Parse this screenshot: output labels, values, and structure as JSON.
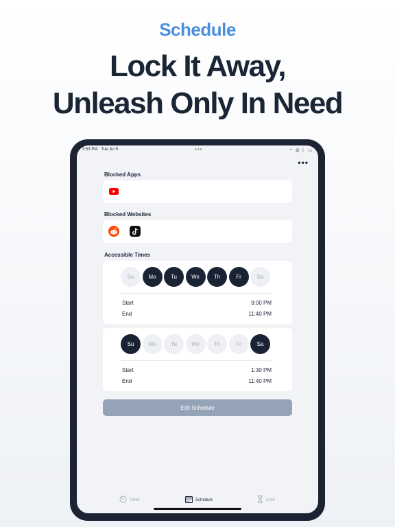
{
  "header": {
    "kicker": "Schedule",
    "headline_line1": "Lock It Away,",
    "headline_line2": "Unleash Only In Need"
  },
  "status_bar": {
    "time": "3:53 PM",
    "date": "Tue Jul 9",
    "dots": "•••",
    "icons": "⌔ ◎ ☾ ▭"
  },
  "more_menu": "•••",
  "blocked_apps": {
    "label": "Blocked Apps",
    "apps": [
      {
        "icon": "youtube-icon"
      }
    ]
  },
  "blocked_websites": {
    "label": "Blocked Websites",
    "sites": [
      {
        "icon": "reddit-icon"
      },
      {
        "icon": "tiktok-icon"
      }
    ]
  },
  "accessible_times": {
    "label": "Accessible Times",
    "schedules": [
      {
        "days": [
          {
            "label": "Su",
            "active": false
          },
          {
            "label": "Mo",
            "active": true
          },
          {
            "label": "Tu",
            "active": true
          },
          {
            "label": "We",
            "active": true
          },
          {
            "label": "Th",
            "active": true
          },
          {
            "label": "Fr",
            "active": true
          },
          {
            "label": "Sa",
            "active": false
          }
        ],
        "start_label": "Start",
        "start": "9:00 PM",
        "end_label": "End",
        "end": "11:40 PM"
      },
      {
        "days": [
          {
            "label": "Su",
            "active": true
          },
          {
            "label": "Mo",
            "active": false
          },
          {
            "label": "Tu",
            "active": false
          },
          {
            "label": "We",
            "active": false
          },
          {
            "label": "Th",
            "active": false
          },
          {
            "label": "Fr",
            "active": false
          },
          {
            "label": "Sa",
            "active": true
          }
        ],
        "start_label": "Start",
        "start": "1:30 PM",
        "end_label": "End",
        "end": "11:40 PM"
      }
    ]
  },
  "edit_button": "Edit Schedule",
  "tabs": [
    {
      "label": "Timer",
      "icon": "timer-icon",
      "selected": false
    },
    {
      "label": "Schedule",
      "icon": "calendar-icon",
      "selected": true
    },
    {
      "label": "Limit",
      "icon": "hourglass-icon",
      "selected": false
    }
  ],
  "colors": {
    "accent": "#4a8fe0",
    "dark": "#1a2333",
    "button": "#95a3b8"
  }
}
